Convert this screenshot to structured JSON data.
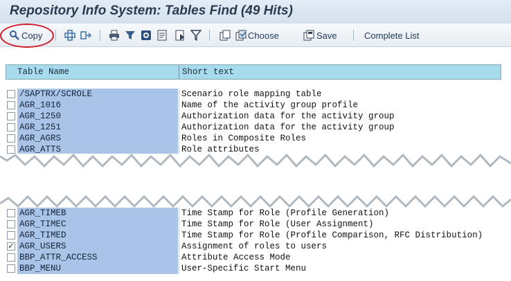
{
  "window": {
    "title": "Repository Info System: Tables Find (49 Hits)"
  },
  "toolbar": {
    "copy_label": "Copy",
    "choose_label": "Choose",
    "save_label": "Save",
    "complete_list_label": "Complete List"
  },
  "table": {
    "columns": [
      "Table Name",
      "Short text"
    ],
    "rows_top": [
      {
        "name": "/SAPTRX/SCROLE",
        "text": "Scenario role mapping table",
        "checked": false
      },
      {
        "name": "AGR_1016",
        "text": "Name of the activity group profile",
        "checked": false
      },
      {
        "name": "AGR_1250",
        "text": "Authorization data for the activity group",
        "checked": false
      },
      {
        "name": "AGR_1251",
        "text": "Authorization data for the activity group",
        "checked": false
      },
      {
        "name": "AGR_AGRS",
        "text": "Roles in Composite Roles",
        "checked": false
      },
      {
        "name": "AGR_ATTS",
        "text": "Role attributes",
        "checked": false
      }
    ],
    "rows_bottom": [
      {
        "name": "AGR_TIMEB",
        "text": "Time Stamp for Role (Profile Generation)",
        "checked": false
      },
      {
        "name": "AGR_TIMEC",
        "text": "Time Stamp for Role (User Assignment)",
        "checked": false
      },
      {
        "name": "AGR_TIMED",
        "text": "Time Stamp for Role (Profile Comparison, RFC Distribution)",
        "checked": false
      },
      {
        "name": "AGR_USERS",
        "text": "Assignment of roles to users",
        "checked": true
      },
      {
        "name": "BBP_ATTR_ACCESS",
        "text": "Attribute Access Mode",
        "checked": false
      },
      {
        "name": "BBP_MENU",
        "text": "User-Specific Start Menu",
        "checked": false
      }
    ]
  },
  "colors": {
    "title_bg": "#d9e5f0",
    "header_bg": "#a8dced",
    "name_cell_bg": "#a9c4e7",
    "highlight_ring": "#d01c2a"
  },
  "icons": {
    "copy": "copy-magnifier-icon",
    "select_all": "select-all-icon",
    "deselect_all": "deselect-all-icon",
    "print": "print-icon",
    "filter": "filter-icon",
    "sort": "sort-icon",
    "details": "details-icon",
    "export": "export-icon",
    "funnel": "funnel-icon",
    "choose": "choose-icon",
    "save": "save-icon"
  }
}
